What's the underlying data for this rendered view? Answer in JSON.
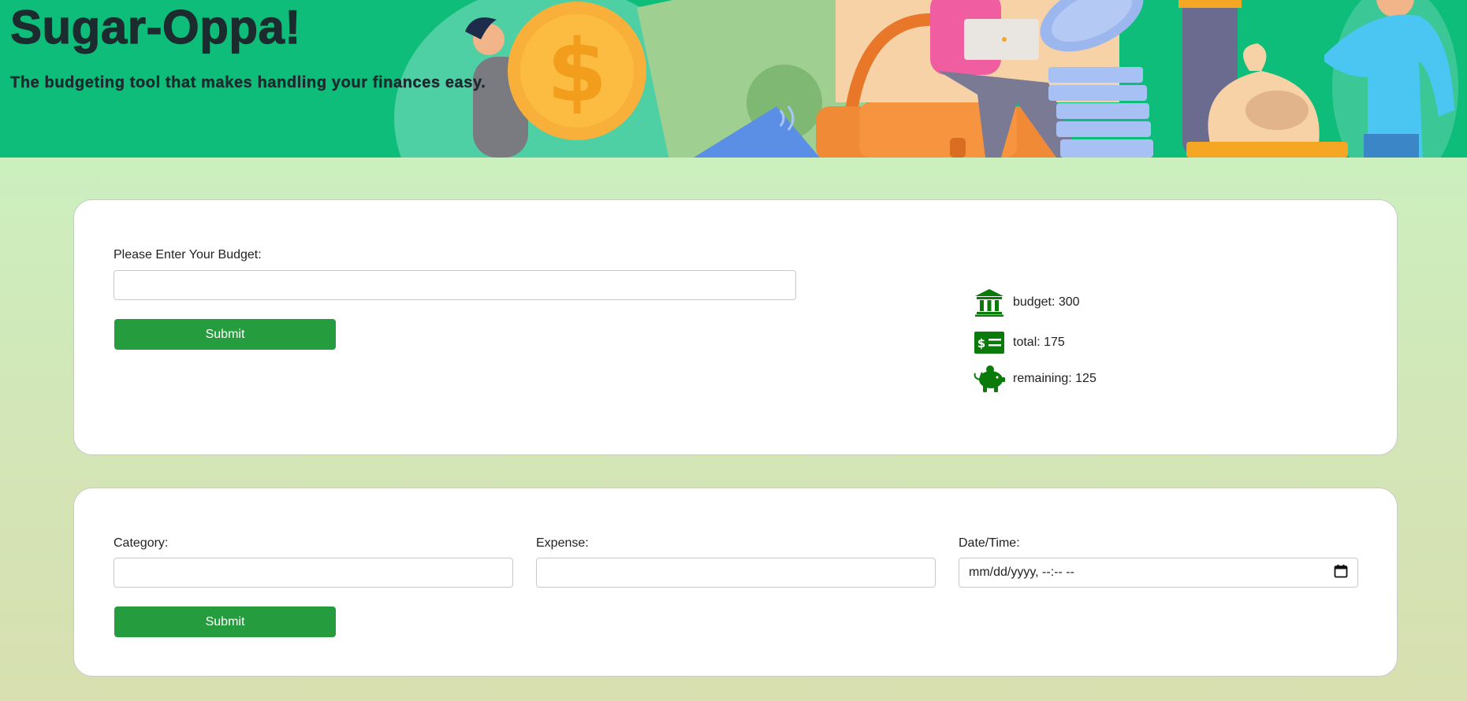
{
  "header": {
    "title": "Sugar-Oppa!",
    "tagline": "The budgeting tool that makes handling your finances easy."
  },
  "budget_form": {
    "label": "Please Enter Your Budget:",
    "input_value": "",
    "submit_label": "Submit"
  },
  "summary": {
    "budget_text": "budget: 300",
    "total_text": "total: 175",
    "remaining_text": "remaining: 125",
    "icons": [
      "bank-icon",
      "money-bill-icon",
      "piggy-bank-icon"
    ],
    "icon_color": "#0a7a0a"
  },
  "expense_form": {
    "category_label": "Category:",
    "category_value": "",
    "expense_label": "Expense:",
    "expense_value": "",
    "datetime_label": "Date/Time:",
    "datetime_placeholder": "mm/dd/yyyy, --:-- --",
    "submit_label": "Submit"
  },
  "colors": {
    "header_bg": "#0dbd79",
    "button_bg": "#259c3e",
    "page_gradient_top": "#c7f5c3",
    "page_gradient_bottom": "#d8dfb0"
  }
}
